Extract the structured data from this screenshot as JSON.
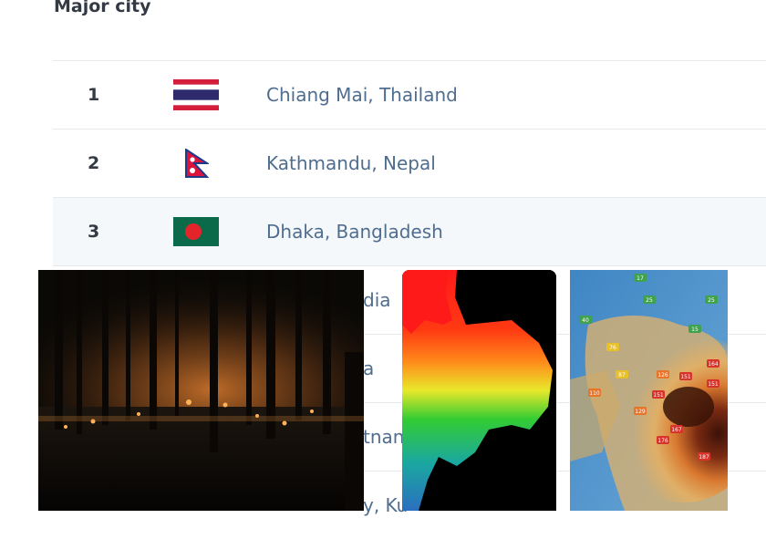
{
  "header": {
    "title": "Major city"
  },
  "rows": [
    {
      "rank": "1",
      "flag_icon": "thailand-flag-icon",
      "city": "Chiang Mai, Thailand"
    },
    {
      "rank": "2",
      "flag_icon": "nepal-flag-icon",
      "city": "Kathmandu, Nepal"
    },
    {
      "rank": "3",
      "flag_icon": "bangladesh-flag-icon",
      "city": "Dhaka, Bangladesh"
    }
  ],
  "partial_rows": [
    {
      "city_fragment": "dia"
    },
    {
      "city_fragment": "a"
    },
    {
      "city_fragment": "tnan"
    },
    {
      "city_fragment": "y, Ku"
    }
  ],
  "aqi_map": {
    "labels": [
      "17",
      "25",
      "25",
      "15",
      "40",
      "76",
      "87",
      "126",
      "151",
      "164",
      "151",
      "151",
      "187",
      "176",
      "167",
      "129",
      "110"
    ]
  },
  "colors": {
    "link_text": "#4f6d8f",
    "rank_text": "#333a44",
    "row_divider": "#e6e9ee",
    "row_highlight": "#f4f8fa",
    "aqi_badge": "#d7332a"
  }
}
